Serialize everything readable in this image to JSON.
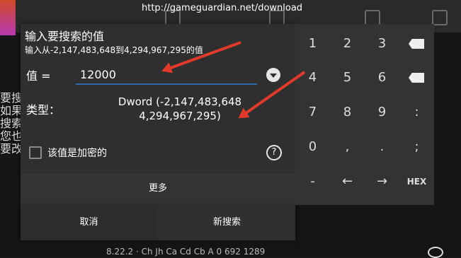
{
  "toolbar": {
    "url": "http://gameguardian.net/download"
  },
  "background": {
    "side_text": [
      "要搜",
      "如果",
      "搜索",
      "您也",
      "要改"
    ],
    "bottom_status": "8.22.2  ·  Ch Jh Ca Cd Cb A   0   692 1289"
  },
  "dialog": {
    "title": "输入要搜索的值",
    "subtitle": "输入从-2,147,483,648到4,294,967,295的值",
    "value_label": "值    =",
    "value_input": "12000",
    "type_label": "类型：",
    "type_value_line1": "Dword (-2,147,483,648",
    "type_value_line2": "4,294,967,295)",
    "encrypted_label": "该值是加密的",
    "help_icon": "?",
    "more_label": "更多",
    "cancel_label": "取消",
    "new_search_label": "新搜索"
  },
  "keypad": {
    "rows": [
      [
        "1",
        "2",
        "3",
        ""
      ],
      [
        "4",
        "5",
        "6",
        ""
      ],
      [
        "7",
        "8",
        "9",
        ":"
      ],
      [
        "0",
        ",",
        ".",
        ";"
      ],
      [
        "-",
        "←",
        "→",
        "HEX"
      ]
    ]
  },
  "colors": {
    "accent": "#2e6ea8",
    "annotation_arrow": "#e23a2a"
  }
}
